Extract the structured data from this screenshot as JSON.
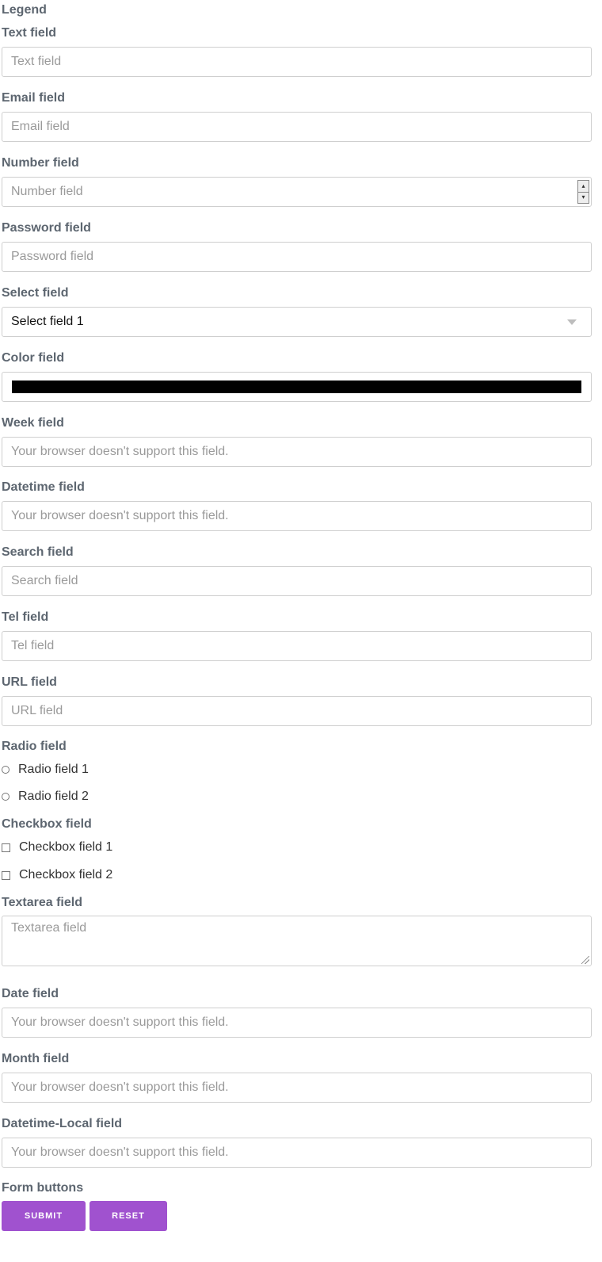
{
  "form": {
    "legend": "Legend",
    "text": {
      "label": "Text field",
      "placeholder": "Text field"
    },
    "email": {
      "label": "Email field",
      "placeholder": "Email field"
    },
    "number": {
      "label": "Number field",
      "placeholder": "Number field"
    },
    "password": {
      "label": "Password field",
      "placeholder": "Password field"
    },
    "select": {
      "label": "Select field",
      "value": "Select field 1"
    },
    "color": {
      "label": "Color field",
      "value": "#000000"
    },
    "week": {
      "label": "Week field",
      "placeholder": "Your browser doesn't support this field."
    },
    "datetime": {
      "label": "Datetime field",
      "placeholder": "Your browser doesn't support this field."
    },
    "search": {
      "label": "Search field",
      "placeholder": "Search field"
    },
    "tel": {
      "label": "Tel field",
      "placeholder": "Tel field"
    },
    "url": {
      "label": "URL field",
      "placeholder": "URL field"
    },
    "radio": {
      "label": "Radio field",
      "options": [
        "Radio field 1",
        "Radio field 2"
      ]
    },
    "checkbox": {
      "label": "Checkbox field",
      "options": [
        "Checkbox field 1",
        "Checkbox field 2"
      ]
    },
    "textarea": {
      "label": "Textarea field",
      "placeholder": "Textarea field"
    },
    "date": {
      "label": "Date field",
      "placeholder": "Your browser doesn't support this field."
    },
    "month": {
      "label": "Month field",
      "placeholder": "Your browser doesn't support this field."
    },
    "datetime_local": {
      "label": "Datetime-Local field",
      "placeholder": "Your browser doesn't support this field."
    },
    "buttons": {
      "label": "Form buttons",
      "submit": "SUBMIT",
      "reset": "RESET"
    }
  },
  "colors": {
    "accent": "#a052cf",
    "label": "#5d6670",
    "border": "#cfcfcf",
    "placeholder": "#9a9a9a"
  }
}
